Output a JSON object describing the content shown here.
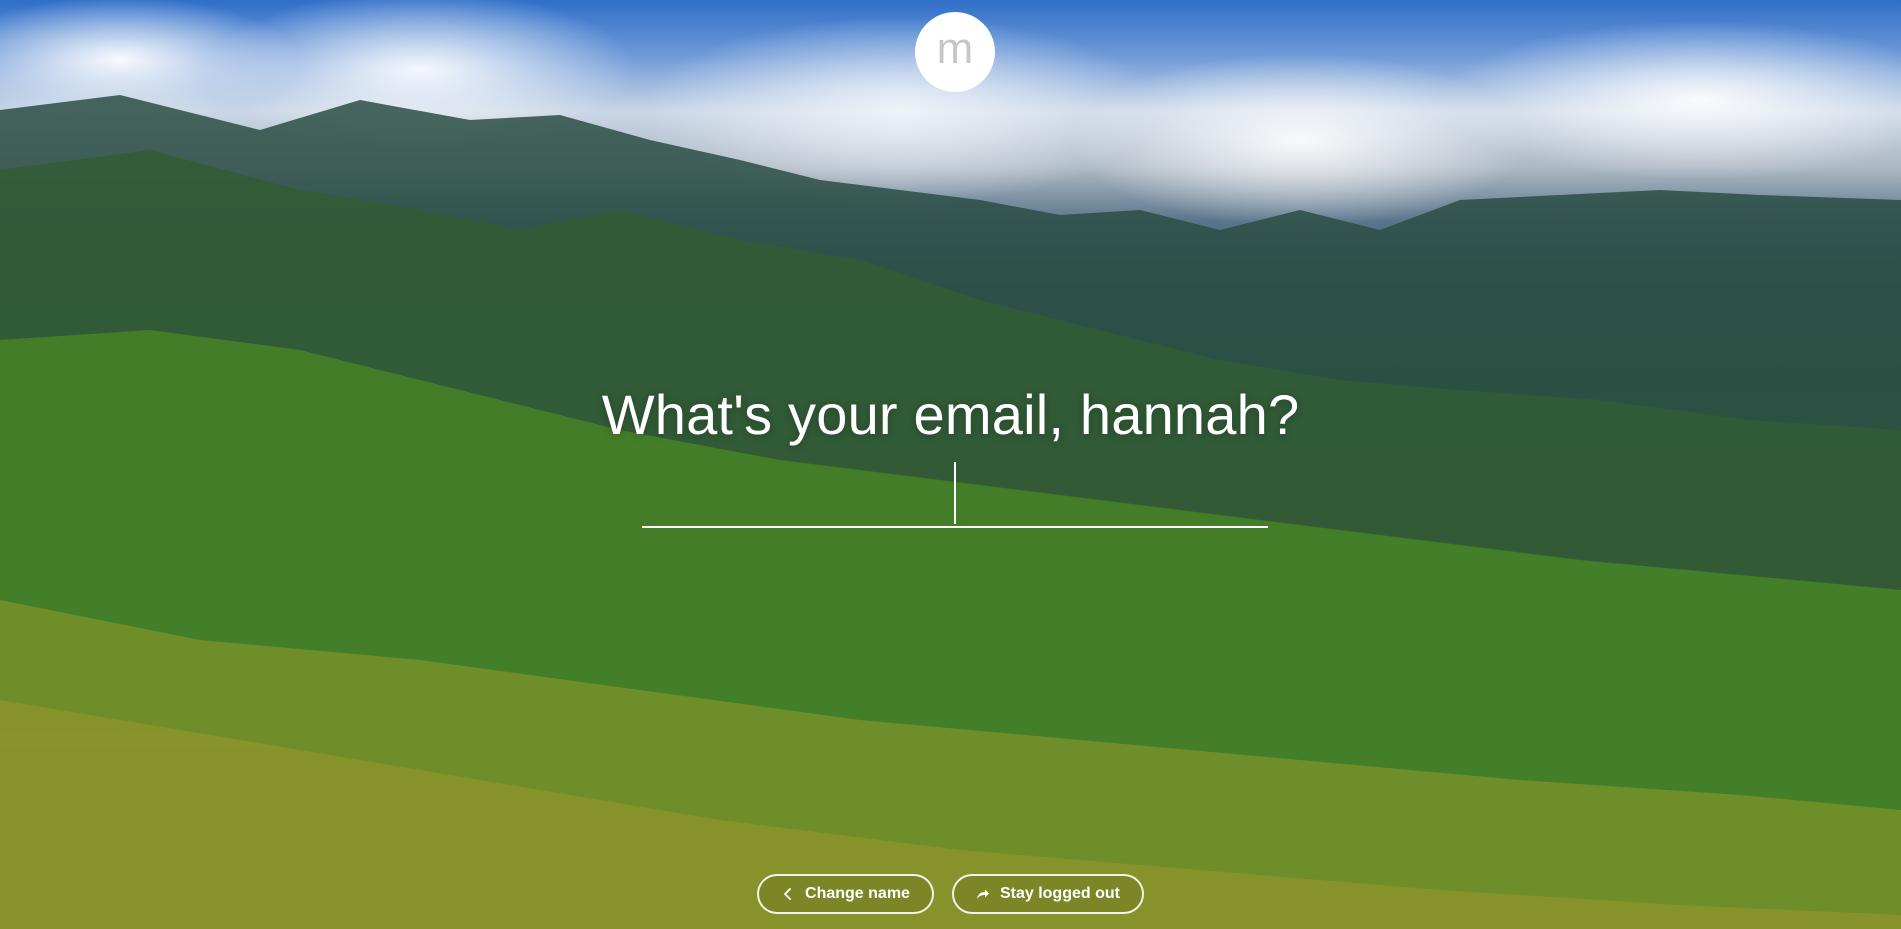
{
  "logo": {
    "letter": "m"
  },
  "prompt": {
    "question": "What's your email, hannah?"
  },
  "email_input": {
    "value": "",
    "placeholder": ""
  },
  "actions": {
    "change_name_label": "Change name",
    "stay_logged_out_label": "Stay logged out"
  },
  "icons": {
    "change_name": "chevron-left-icon",
    "stay_logged_out": "share-arrow-icon"
  },
  "colors": {
    "text": "#ffffff",
    "logo_bg": "#ffffff",
    "logo_letter": "#c7c7c7"
  }
}
